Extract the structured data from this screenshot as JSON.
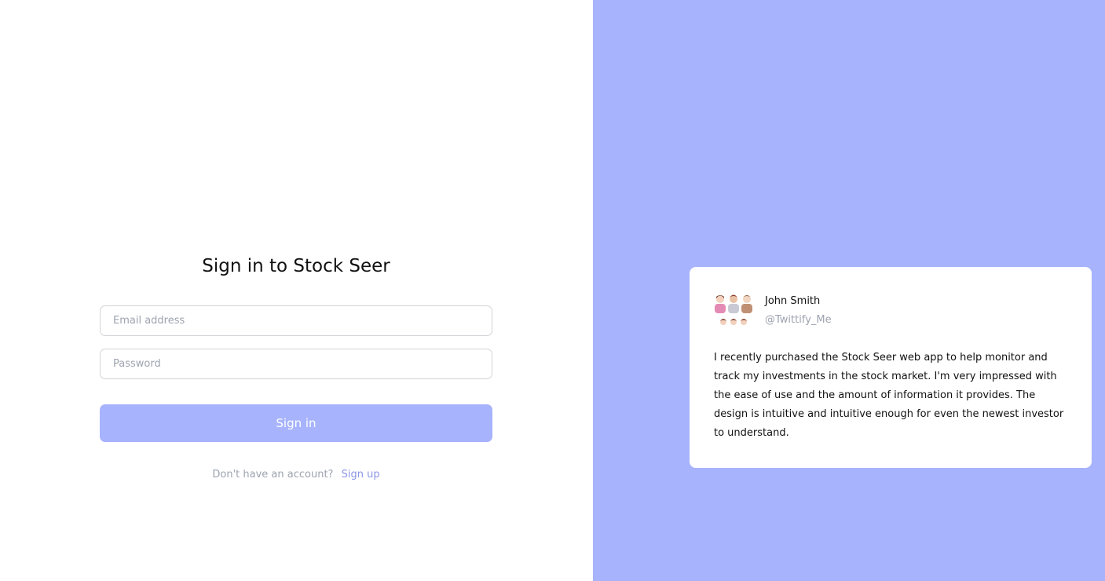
{
  "signin": {
    "title": "Sign in to Stock Seer",
    "email_placeholder": "Email address",
    "password_placeholder": "Password",
    "submit_label": "Sign in",
    "signup_prompt": "Don't have an account?",
    "signup_link": "Sign up"
  },
  "testimonial": {
    "author_name": "John Smith",
    "author_handle": "@Twittify_Me",
    "text": "I recently purchased the Stock Seer web app to help monitor and track my investments in the stock market. I'm very impressed with the ease of use and the amount of information it provides. The design is intuitive and intuitive enough for even the newest investor to understand."
  },
  "colors": {
    "accent": "#a7b3fc",
    "link": "#8b95e8",
    "muted_text": "#9ca3af"
  }
}
